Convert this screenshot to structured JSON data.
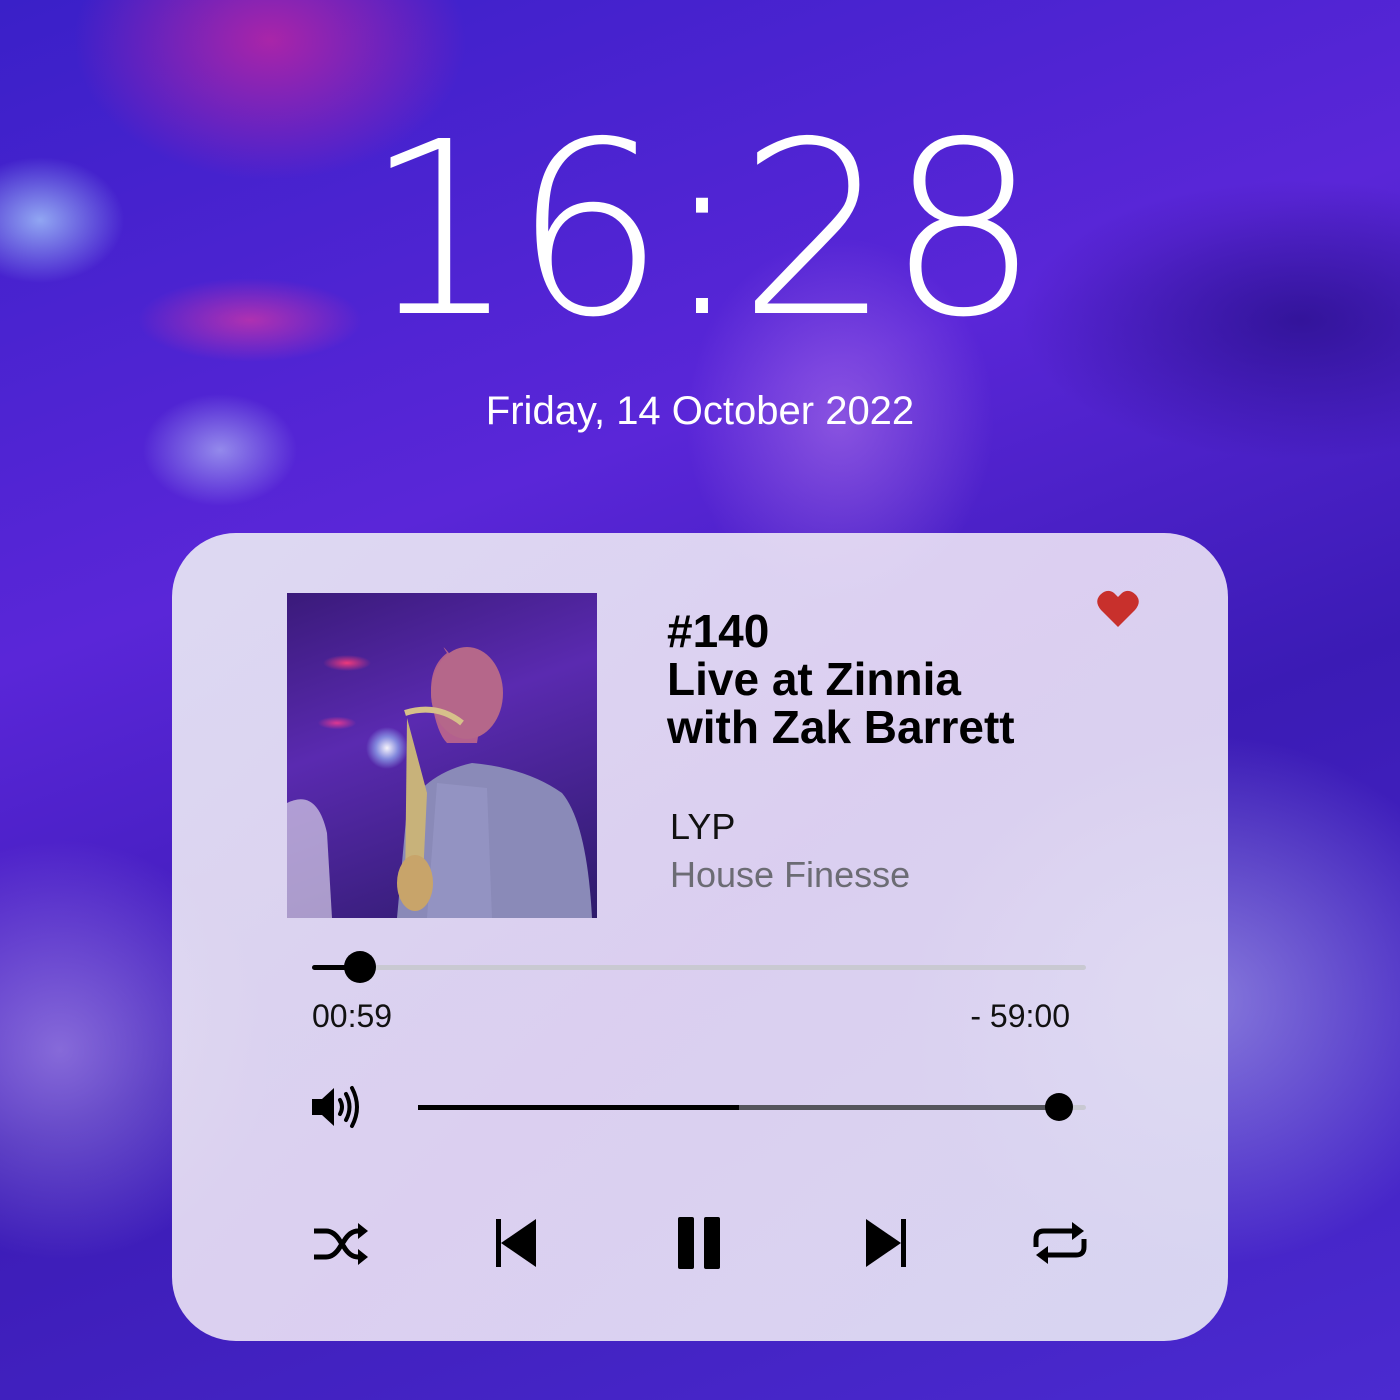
{
  "lockscreen": {
    "time": "16:28",
    "date": "Friday, 14 October 2022"
  },
  "player": {
    "title_lines": [
      "#140",
      "Live at Zinnia",
      "with Zak Barrett"
    ],
    "artist": "LYP",
    "album": "House Finesse",
    "liked": true,
    "progress": {
      "elapsed": "00:59",
      "remaining": "- 59:00",
      "fraction": 0.062
    },
    "volume": {
      "level": 0.96,
      "buffered": 0.48
    },
    "controls": [
      "shuffle-icon",
      "previous-icon",
      "pause-icon",
      "next-icon",
      "repeat-icon"
    ],
    "colors": {
      "heart": "#c8302c",
      "accent": "#000000"
    }
  }
}
